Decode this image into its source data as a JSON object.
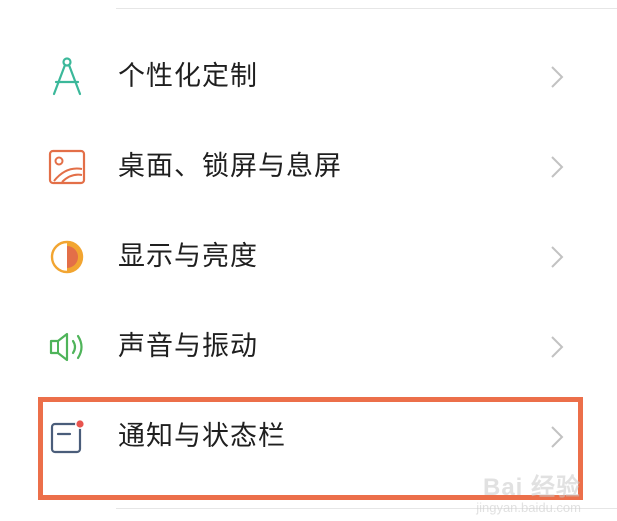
{
  "settings": {
    "items": [
      {
        "label": "个性化定制",
        "icon": "compass-icon",
        "color": "#3bb89a"
      },
      {
        "label": "桌面、锁屏与息屏",
        "icon": "wallpaper-icon",
        "color": "#e36f48"
      },
      {
        "label": "显示与亮度",
        "icon": "brightness-icon",
        "color": "#f2a531"
      },
      {
        "label": "声音与振动",
        "icon": "speaker-icon",
        "color": "#4fb45a"
      },
      {
        "label": "通知与状态栏",
        "icon": "notification-icon",
        "color": "#4a5d7a"
      }
    ]
  },
  "highlight": {
    "color": "#ec6f4a",
    "target": "通知与状态栏"
  },
  "watermark": {
    "brand": "Bai 经验",
    "url": "jingyan.baidu.com"
  }
}
